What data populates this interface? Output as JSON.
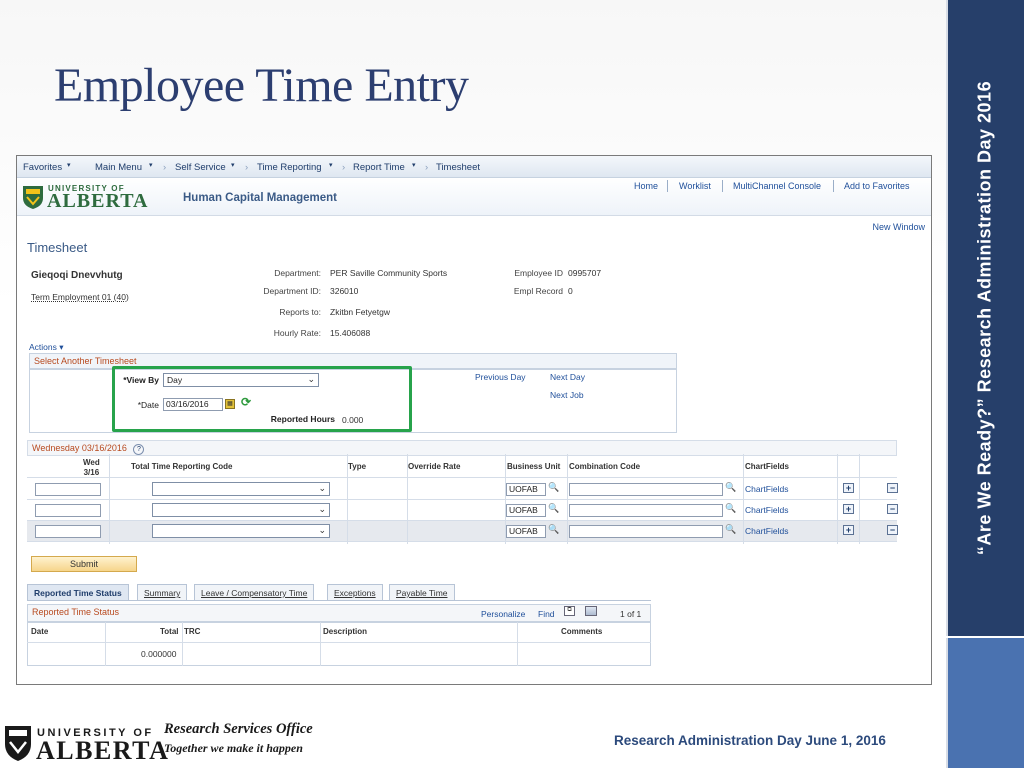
{
  "slide": {
    "title": "Employee Time Entry",
    "band_text": "“Are We Ready?” Research Administration Day 2016",
    "footer_univ": "UNIVERSITY OF",
    "footer_alberta": "ALBERTA",
    "footer_org": "Research Services Office",
    "footer_tagline": "Together we make it happen",
    "footer_event": "Research Administration Day June 1, 2016"
  },
  "nav": {
    "favorites": "Favorites",
    "main_menu": "Main Menu",
    "self_service": "Self Service",
    "time_reporting": "Time Reporting",
    "report_time": "Report Time",
    "timesheet": "Timesheet",
    "sep": "›"
  },
  "header": {
    "logo_univ": "UNIVERSITY OF",
    "logo_alberta": "ALBERTA",
    "app_title": "Human Capital Management",
    "links": [
      "Home",
      "Worklist",
      "MultiChannel Console",
      "Add to Favorites"
    ],
    "new_window": "New Window"
  },
  "timesheet": {
    "title": "Timesheet",
    "employee_name": "Gieqoqi Dnevvhutg",
    "employment": "Term Employment 01 (40)",
    "department_label": "Department:",
    "department_value": "PER Saville Community Sports",
    "dept_id_label": "Department ID:",
    "dept_id_value": "326010",
    "reports_to_label": "Reports to:",
    "reports_to_value": "Zkitbn Fetyetgw",
    "hourly_rate_label": "Hourly Rate:",
    "hourly_rate_value": "15.406088",
    "employee_id_label": "Employee ID",
    "employee_id_value": "0995707",
    "empl_record_label": "Empl Record",
    "empl_record_value": "0",
    "actions": "Actions",
    "select_another": "Select Another Timesheet",
    "view_by_label": "*View By",
    "view_by_value": "Day",
    "date_label": "*Date",
    "date_value": "03/16/2016",
    "reported_hours_label": "Reported Hours",
    "reported_hours_value": "0.000",
    "previous_day": "Previous Day",
    "next_day": "Next Day",
    "next_job": "Next Job"
  },
  "grid": {
    "day_header": "Wednesday 03/16/2016",
    "help": "?",
    "col_day": "Wed",
    "col_day_date": "3/16",
    "col_trc": "Total Time Reporting Code",
    "col_type": "Type",
    "col_override": "Override Rate",
    "col_bu": "Business Unit",
    "col_combo": "Combination Code",
    "col_chartfields": "ChartFields",
    "rows": [
      {
        "bu": "UOFAB",
        "chartfields": "ChartFields"
      },
      {
        "bu": "UOFAB",
        "chartfields": "ChartFields"
      },
      {
        "bu": "UOFAB",
        "chartfields": "ChartFields"
      }
    ],
    "submit": "Submit"
  },
  "tabs": [
    "Reported Time Status",
    "Summary",
    "Leave / Compensatory Time",
    "Exceptions",
    "Payable Time"
  ],
  "status": {
    "title": "Reported Time Status",
    "personalize": "Personalize",
    "find": "Find",
    "paging": "1 of 1",
    "col_date": "Date",
    "col_total": "Total",
    "col_trc": "TRC",
    "col_description": "Description",
    "col_comments": "Comments",
    "total_value": "0.000000"
  }
}
